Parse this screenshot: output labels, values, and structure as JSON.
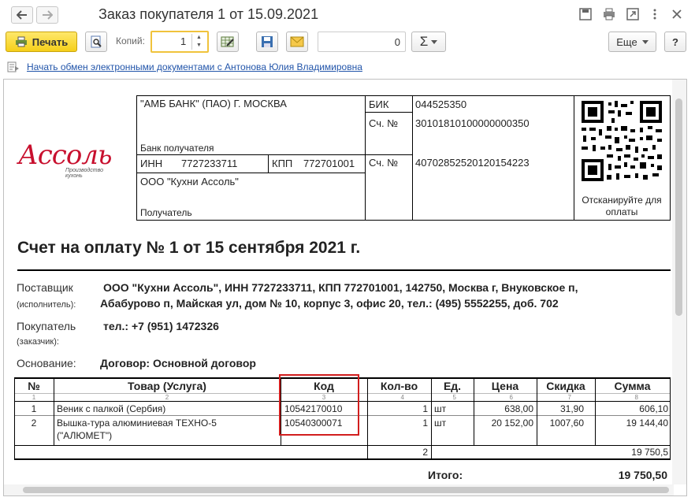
{
  "window": {
    "title": "Заказ покупателя 1 от 15.09.2021"
  },
  "toolbar": {
    "print_label": "Печать",
    "copies_label": "Копий:",
    "copies_value": "1",
    "number_value": "0",
    "sum_label": "Σ",
    "more_label": "Еще",
    "help_label": "?"
  },
  "edo_link": "Начать обмен электронными документами с Антоновa Юлия Владимировна",
  "document": {
    "logo_text": "Ассоль",
    "logo_subtext": "Производство кухонь",
    "bank_name": "\"АМБ БАНК\" (ПАО) Г. МОСКВА",
    "bank_label": "Банк получателя",
    "bik_label": "БИК",
    "bik_value": "044525350",
    "corr_label": "Сч. №",
    "corr_value": "30101810100000000350",
    "inn_label": "ИНН",
    "inn_value": "7727233711",
    "kpp_label": "КПП",
    "kpp_value": "772701001",
    "acc_label": "Сч. №",
    "acc_value": "40702852520120154223",
    "recipient_name": "ООО \"Кухни Ассоль\"",
    "recipient_label": "Получатель",
    "qr_caption": "Отсканируйте для оплаты",
    "heading": "Счет на оплату № 1 от 15 сентября 2021 г.",
    "supplier_label": "Поставщик",
    "supplier_sublabel": "(исполнитель):",
    "supplier_line1": "ООО \"Кухни Ассоль\",  ИНН 7727233711,  КПП 772701001,  142750, Москва г, Внуковское п,",
    "supplier_line2": "Абабурово п, Майская ул, дом № 10, корпус 3, офис 20,  тел.: (495) 5552255, доб. 702",
    "buyer_label": "Покупатель",
    "buyer_sublabel": "(заказчик):",
    "buyer_value": "тел.: +7 (951) 1472326",
    "basis_label": "Основание:",
    "basis_value": "Договор: Основной договор",
    "table": {
      "headers": [
        "№",
        "Товар (Услуга)",
        "Код",
        "Кол-во",
        "Ед.",
        "Цена",
        "Скидка",
        "Сумма"
      ],
      "numbers": [
        "1",
        "2",
        "3",
        "4",
        "5",
        "6",
        "7",
        "8"
      ],
      "rows": [
        {
          "n": "1",
          "name": "Веник с палкой (Сербия)",
          "name2": "",
          "code": "10542170010",
          "qty": "1",
          "unit": "шт",
          "price": "638,00",
          "discount": "31,90",
          "sum": "606,10"
        },
        {
          "n": "2",
          "name": "Вышка-тура алюминиевая ТЕХНО-5",
          "name2": "(\"АЛЮМЕТ\")",
          "code": "10540300071",
          "qty": "1",
          "unit": "шт",
          "price": "20 152,00",
          "discount": "1007,60",
          "sum": "19 144,40"
        }
      ],
      "total_qty": "2",
      "total_sum": "19 750,5"
    },
    "total_label": "Итого:",
    "total_value": "19 750,50"
  }
}
